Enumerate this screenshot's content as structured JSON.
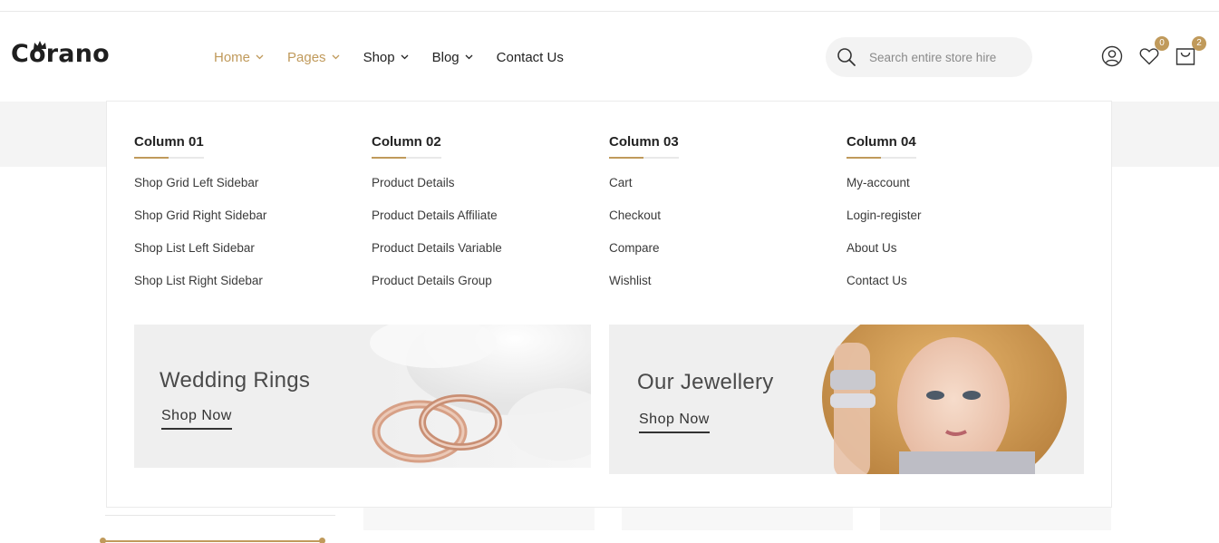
{
  "brand": {
    "name": "Corano"
  },
  "nav": {
    "items": [
      {
        "label": "Home",
        "active": true,
        "has_dropdown": true
      },
      {
        "label": "Pages",
        "active": true,
        "has_dropdown": true
      },
      {
        "label": "Shop",
        "active": false,
        "has_dropdown": true
      },
      {
        "label": "Blog",
        "active": false,
        "has_dropdown": true
      },
      {
        "label": "Contact Us",
        "active": false,
        "has_dropdown": false
      }
    ]
  },
  "search": {
    "placeholder": "Search entire store hire",
    "value": ""
  },
  "header_icons": {
    "account": {
      "icon": "user-icon"
    },
    "wishlist": {
      "icon": "heart-icon",
      "count": "0"
    },
    "cart": {
      "icon": "cart-icon",
      "count": "2"
    }
  },
  "mega_menu": {
    "columns": [
      {
        "title": "Column 01",
        "links": [
          "Shop Grid Left Sidebar",
          "Shop Grid Right Sidebar",
          "Shop List Left Sidebar",
          "Shop List Right Sidebar"
        ]
      },
      {
        "title": "Column 02",
        "links": [
          "Product Details",
          "Product Details Affiliate",
          "Product Details Variable",
          "Product Details Group"
        ]
      },
      {
        "title": "Column 03",
        "links": [
          "Cart",
          "Checkout",
          "Compare",
          "Wishlist"
        ]
      },
      {
        "title": "Column 04",
        "links": [
          "My-account",
          "Login-register",
          "About Us",
          "Contact Us"
        ]
      }
    ],
    "banners": [
      {
        "title": "Wedding Rings",
        "link_label": "Shop Now"
      },
      {
        "title": "Our Jewellery",
        "link_label": "Shop Now"
      }
    ]
  },
  "colors": {
    "accent": "#c09a5b",
    "text": "#222222",
    "background_band": "#f4f4f4"
  }
}
